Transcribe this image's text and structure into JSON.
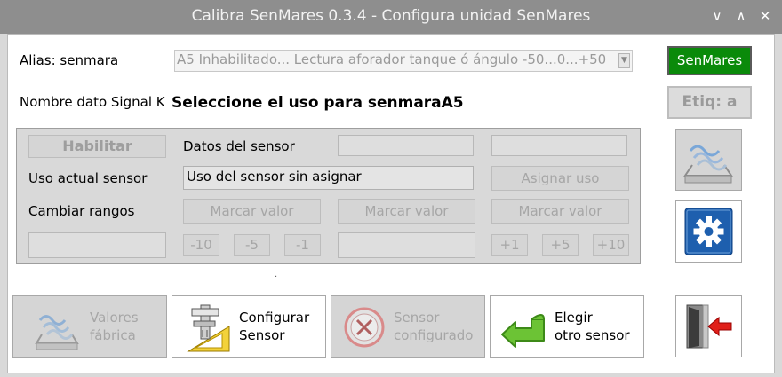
{
  "window": {
    "title": "Calibra SenMares 0.3.4 - Configura unidad SenMares",
    "controls": {
      "minimize": "∨",
      "maximize": "∧",
      "close": "✕"
    }
  },
  "alias": {
    "label": "Alias: senmara",
    "combo_value": "A5 Inhabilitado... Lectura aforador tanque ó ángulo -50...0...+50"
  },
  "signalk": {
    "label": "Nombre dato Signal K",
    "value": "Seleccione el uso para senmaraA5"
  },
  "buttons": {
    "senmares": "SenMares",
    "etiq": "Etiq: a"
  },
  "panel": {
    "habilitar": "Habilitar",
    "datos_sensor_label": "Datos del sensor",
    "uso_actual_label": "Uso actual sensor",
    "uso_actual_value": "Uso del sensor sin asignar",
    "asignar_uso": "Asignar uso",
    "cambiar_rangos_label": "Cambiar rangos",
    "marcar_valor": [
      "Marcar valor",
      "Marcar valor",
      "Marcar valor"
    ],
    "decrements": [
      "-10",
      "-5",
      "-1"
    ],
    "increments": [
      "+1",
      "+5",
      "+10"
    ]
  },
  "bottom": {
    "valores_fabrica": [
      "Valores",
      "fábrica"
    ],
    "configurar_sensor": [
      "Configurar",
      "Sensor"
    ],
    "sensor_configurado": [
      "Sensor",
      "configurado"
    ],
    "elegir_otro": [
      "Elegir",
      "otro sensor"
    ]
  },
  "colors": {
    "title_bar": "#8e8e8e",
    "senmares_green": "#0a8a0a",
    "settings_blue": "#1e5fae",
    "arrow_green": "#5fbf2a",
    "exit_red": "#e0201a"
  }
}
